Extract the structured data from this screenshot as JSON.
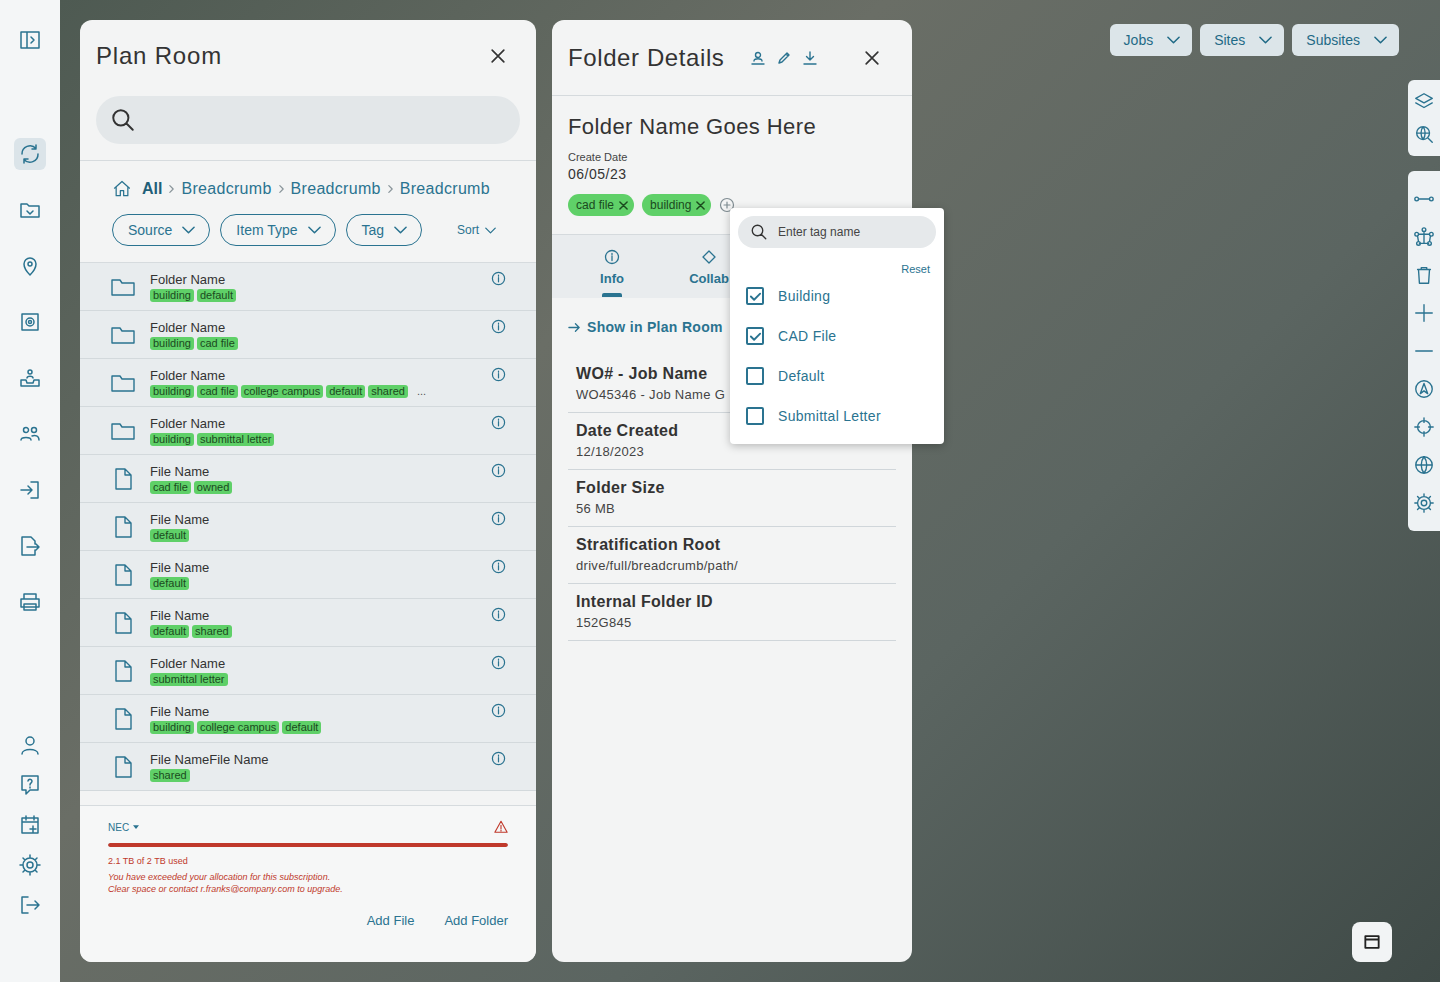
{
  "rail": {
    "top_items": [
      {
        "selected": false
      },
      {
        "selected": true
      },
      {
        "selected": false
      },
      {
        "selected": false
      },
      {
        "selected": false
      },
      {
        "selected": false
      },
      {
        "selected": false
      },
      {
        "selected": false
      },
      {
        "selected": false
      },
      {
        "selected": false
      }
    ],
    "bottom_items": [
      {
        "selected": false
      },
      {
        "selected": false
      },
      {
        "selected": false
      },
      {
        "selected": false
      },
      {
        "selected": false
      }
    ]
  },
  "map_filters": [
    {
      "label": "Jobs"
    },
    {
      "label": "Sites"
    },
    {
      "label": "Subsites"
    }
  ],
  "plan_room": {
    "title": "Plan Room",
    "home": "All",
    "breadcrumb": [
      "Breadcrumb",
      "Breadcrumb",
      "Breadcrumb"
    ],
    "filters": [
      {
        "label": "Source"
      },
      {
        "label": "Item Type"
      },
      {
        "label": "Tag"
      }
    ],
    "sort": "Sort",
    "items": [
      {
        "name": "Folder Name",
        "kind": "folder",
        "tags": [
          "building",
          "default"
        ]
      },
      {
        "name": "Folder Name",
        "kind": "folder",
        "tags": [
          "building",
          "cad file"
        ]
      },
      {
        "name": "Folder Name",
        "kind": "folder",
        "tags": [
          "building",
          "cad file",
          "college campus",
          "default",
          "shared"
        ],
        "more": "..."
      },
      {
        "name": "Folder Name",
        "kind": "folder",
        "tags": [
          "building",
          "submittal letter"
        ]
      },
      {
        "name": "File Name",
        "kind": "file",
        "tags": [
          "cad file",
          "owned"
        ]
      },
      {
        "name": "File Name",
        "kind": "file",
        "tags": [
          "default"
        ]
      },
      {
        "name": "File Name",
        "kind": "file",
        "tags": [
          "default"
        ]
      },
      {
        "name": "File Name",
        "kind": "file",
        "tags": [
          "default",
          "shared"
        ]
      },
      {
        "name": "Folder Name",
        "kind": "file",
        "tags": [
          "submittal letter"
        ]
      },
      {
        "name": "File Name",
        "kind": "file",
        "tags": [
          "building",
          "college campus",
          "default"
        ]
      },
      {
        "name": "File NameFile Name",
        "kind": "file",
        "tags": [
          "shared"
        ]
      }
    ],
    "storage": {
      "plan": "NEC",
      "usage": "2.1 TB of 2 TB used",
      "level": 1,
      "over_limit": true,
      "message": [
        "You have exceeded your allocation for this subscription.",
        "Clear space or contact r.franks@company.com to upgrade."
      ]
    },
    "actions": [
      "Add File",
      "Add Folder"
    ]
  },
  "folder_details": {
    "title": "Folder Details",
    "name": "Folder Name Goes Here",
    "create_date_label": "Create Date",
    "create_date": "06/05/23",
    "tags": [
      "cad file",
      "building"
    ],
    "tabs": [
      {
        "label": "Info",
        "selected": true
      },
      {
        "label": "Collab",
        "selected": false
      }
    ],
    "link": "Show in Plan Room",
    "fields": [
      {
        "label": "WO# - Job Name",
        "value": "WO45346 - Job Name G"
      },
      {
        "label": "Date Created",
        "value": "12/18/2023"
      },
      {
        "label": "Folder Size",
        "value": "56 MB"
      },
      {
        "label": "Stratification Root",
        "value": "drive/full/breadcrumb/path/"
      },
      {
        "label": "Internal Folder ID",
        "value": "152G845"
      }
    ]
  },
  "tag_menu": {
    "placeholder": "Enter tag name",
    "reset": "Reset",
    "options": [
      {
        "label": "Building",
        "checked": true
      },
      {
        "label": "CAD File",
        "checked": true
      },
      {
        "label": "Default",
        "checked": false
      },
      {
        "label": "Submittal Letter",
        "checked": false
      }
    ]
  }
}
